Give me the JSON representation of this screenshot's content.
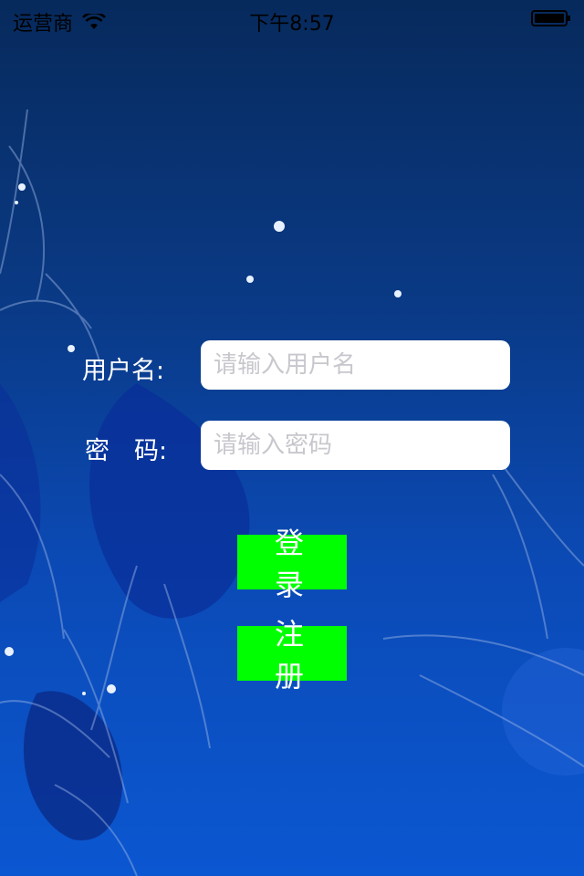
{
  "status_bar": {
    "carrier": "运营商",
    "time": "下午8:57"
  },
  "form": {
    "username_label": "用户名:",
    "username_placeholder": "请输入用户名",
    "password_label": "密　码:",
    "password_placeholder": "请输入密码"
  },
  "buttons": {
    "login_label": "登录",
    "register_label": "注册"
  },
  "colors": {
    "button_green": "#00ff00",
    "background_top": "#072a5c",
    "background_bottom": "#0b57d1"
  }
}
